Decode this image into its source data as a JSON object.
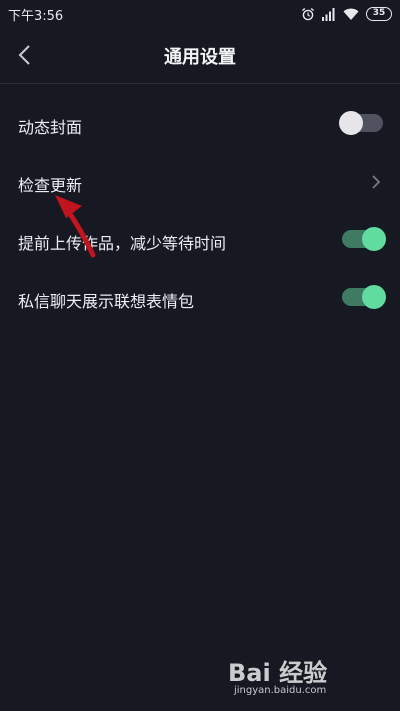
{
  "status_bar": {
    "time": "下午3:56",
    "battery_level": "35",
    "icons": [
      "alarm-icon",
      "signal-icon",
      "wifi-icon",
      "battery-icon"
    ]
  },
  "header": {
    "title": "通用设置",
    "back_icon": "chevron-left-icon"
  },
  "settings": [
    {
      "label": "动态封面",
      "control": "toggle",
      "enabled": false
    },
    {
      "label": "检查更新",
      "control": "chevron"
    },
    {
      "label": "提前上传作品，减少等待时间",
      "control": "toggle",
      "enabled": true
    },
    {
      "label": "私信聊天展示联想表情包",
      "control": "toggle",
      "enabled": true
    }
  ],
  "watermark": {
    "logo": "Bai 经验",
    "url": "jingyan.baidu.com"
  },
  "colors": {
    "background": "#161822",
    "toggle_on_track": "#3e7b62",
    "toggle_on_knob": "#5fdc9e",
    "toggle_off_track": "#505260",
    "annotation_arrow": "#c0141e"
  }
}
